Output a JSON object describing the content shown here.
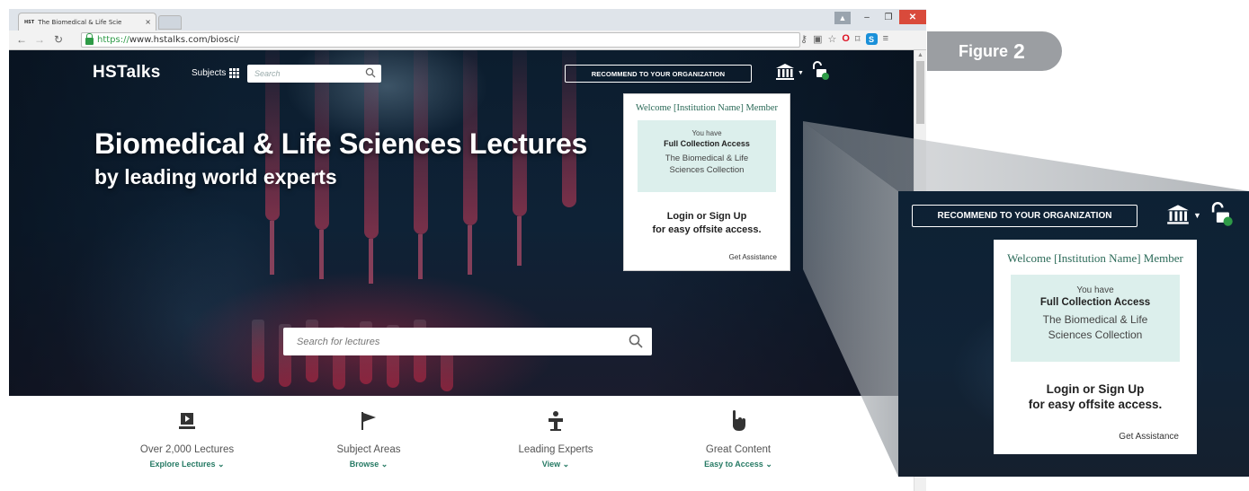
{
  "browser": {
    "tab_title": "The Biomedical & Life Scie",
    "tab_favicon": "HST",
    "tab_close": "×",
    "url_https": "https://",
    "url_rest": "www.hstalks.com/biosci/"
  },
  "header": {
    "logo": "HSTalks",
    "subjects_label": "Subjects",
    "search_placeholder": "Search",
    "recommend_label": "RECOMMEND TO YOUR ORGANIZATION"
  },
  "hero": {
    "title": "Biomedical & Life Sciences Lectures",
    "subtitle": "by leading world experts",
    "lecture_search_placeholder": "Search for lectures"
  },
  "welcome": {
    "title": "Welcome [Institution Name] Member",
    "you_have": "You have",
    "access": "Full Collection Access",
    "collection": "The Biomedical & Life Sciences Collection",
    "login_line1": "Login or Sign Up",
    "login_line2": "for easy offsite access.",
    "assistance": "Get Assistance"
  },
  "features": [
    {
      "title": "Over 2,000 Lectures",
      "link": "Explore Lectures",
      "icon": "video-icon"
    },
    {
      "title": "Subject Areas",
      "link": "Browse",
      "icon": "flag-icon"
    },
    {
      "title": "Leading Experts",
      "link": "View",
      "icon": "lectern-icon"
    },
    {
      "title": "Great Content",
      "link": "Easy to Access",
      "icon": "touch-icon"
    }
  ],
  "figure": {
    "label": "Figure",
    "number": "2"
  },
  "colors": {
    "accent_green": "#267a64",
    "welcome_green": "#2b6a58",
    "access_box": "#dcefec",
    "hero_dark": "#0e2236",
    "figure_gray": "#9b9ea2"
  }
}
